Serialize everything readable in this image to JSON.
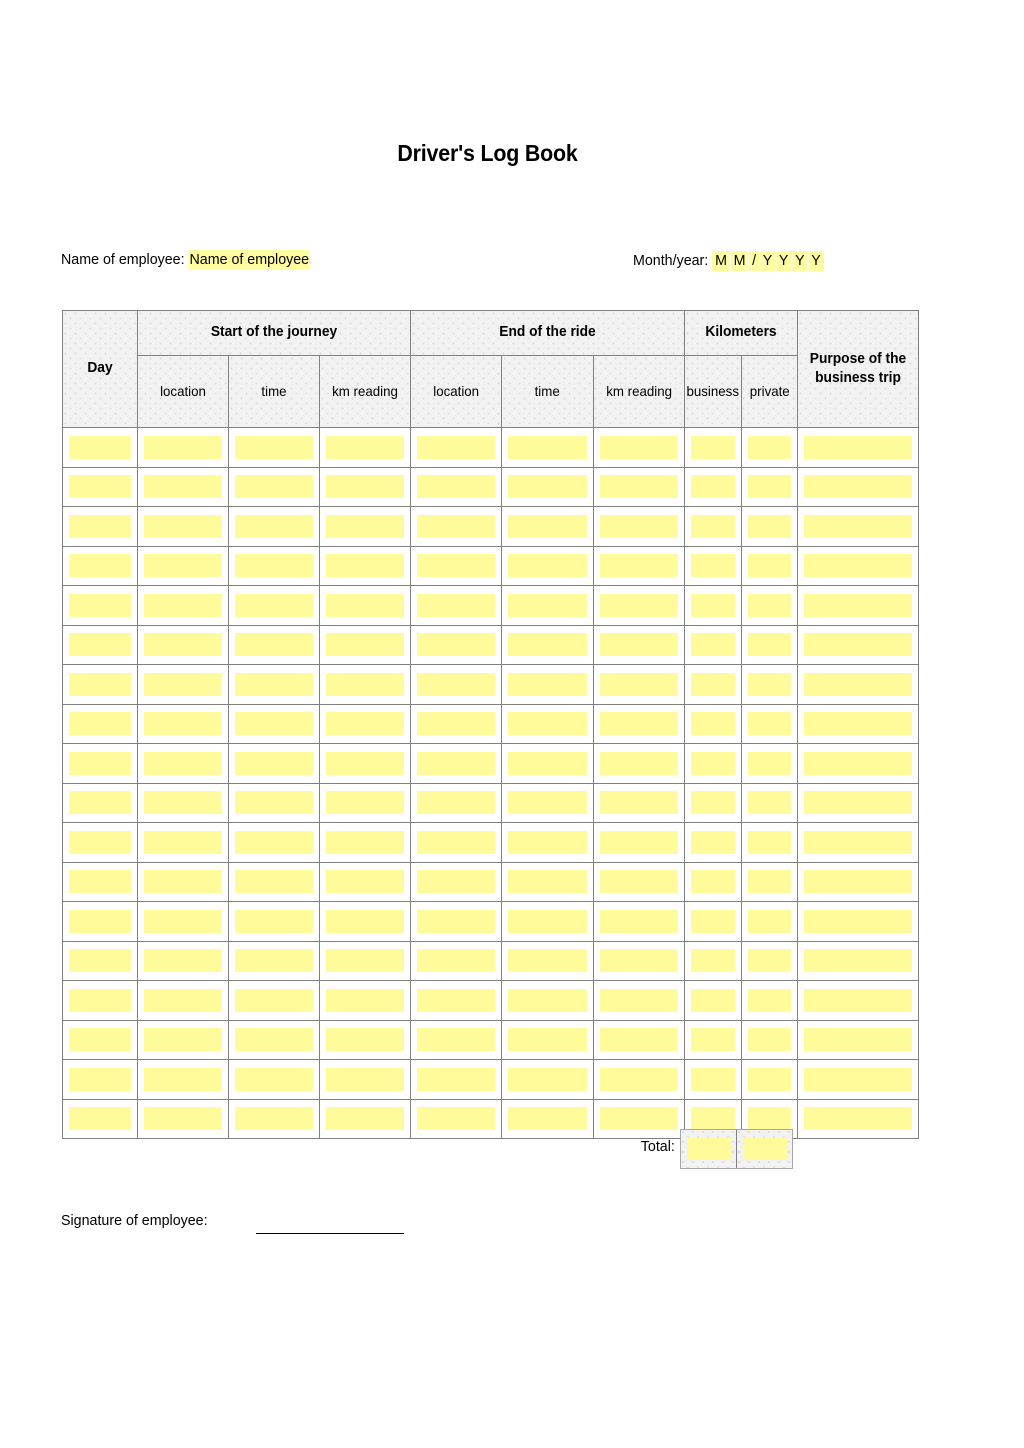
{
  "document": {
    "title": "Driver's Log Book"
  },
  "meta": {
    "employee_label": "Name of employee:",
    "employee_value": "Name of employee",
    "month_label": "Month/year:",
    "month_value": "MM / YYYY",
    "month_chars": [
      "M",
      "M",
      "/",
      "Y",
      "Y",
      "Y",
      "Y"
    ]
  },
  "table": {
    "group_headers": {
      "day": "Day",
      "start": "Start of the journey",
      "end": "End of the ride",
      "kilometers": "Kilometers",
      "purpose": "Purpose of the business trip"
    },
    "sub_headers": {
      "start_location": "location",
      "start_time": "time",
      "start_km": "km reading",
      "end_location": "location",
      "end_time": "time",
      "end_km": "km reading",
      "km_business": "business",
      "km_private": "private"
    },
    "row_count": 18,
    "columns": [
      "day",
      "start_location",
      "start_time",
      "start_km",
      "end_location",
      "end_time",
      "end_km",
      "km_business",
      "km_private",
      "purpose"
    ],
    "rows": [
      [
        "",
        "",
        "",
        "",
        "",
        "",
        "",
        "",
        "",
        ""
      ],
      [
        "",
        "",
        "",
        "",
        "",
        "",
        "",
        "",
        "",
        ""
      ],
      [
        "",
        "",
        "",
        "",
        "",
        "",
        "",
        "",
        "",
        ""
      ],
      [
        "",
        "",
        "",
        "",
        "",
        "",
        "",
        "",
        "",
        ""
      ],
      [
        "",
        "",
        "",
        "",
        "",
        "",
        "",
        "",
        "",
        ""
      ],
      [
        "",
        "",
        "",
        "",
        "",
        "",
        "",
        "",
        "",
        ""
      ],
      [
        "",
        "",
        "",
        "",
        "",
        "",
        "",
        "",
        "",
        ""
      ],
      [
        "",
        "",
        "",
        "",
        "",
        "",
        "",
        "",
        "",
        ""
      ],
      [
        "",
        "",
        "",
        "",
        "",
        "",
        "",
        "",
        "",
        ""
      ],
      [
        "",
        "",
        "",
        "",
        "",
        "",
        "",
        "",
        "",
        ""
      ],
      [
        "",
        "",
        "",
        "",
        "",
        "",
        "",
        "",
        "",
        ""
      ],
      [
        "",
        "",
        "",
        "",
        "",
        "",
        "",
        "",
        "",
        ""
      ],
      [
        "",
        "",
        "",
        "",
        "",
        "",
        "",
        "",
        "",
        ""
      ],
      [
        "",
        "",
        "",
        "",
        "",
        "",
        "",
        "",
        "",
        ""
      ],
      [
        "",
        "",
        "",
        "",
        "",
        "",
        "",
        "",
        "",
        ""
      ],
      [
        "",
        "",
        "",
        "",
        "",
        "",
        "",
        "",
        "",
        ""
      ],
      [
        "",
        "",
        "",
        "",
        "",
        "",
        "",
        "",
        "",
        ""
      ],
      [
        "",
        "",
        "",
        "",
        "",
        "",
        "",
        "",
        "",
        ""
      ]
    ]
  },
  "total": {
    "label": "Total:",
    "business_value": "",
    "private_value": ""
  },
  "signature": {
    "label": "Signature of employee:",
    "value": ""
  },
  "colors": {
    "field_fill": "#fffb9b",
    "highlight": "#fffda0",
    "header_bg": "#f2f2f2",
    "border": "#808080"
  }
}
